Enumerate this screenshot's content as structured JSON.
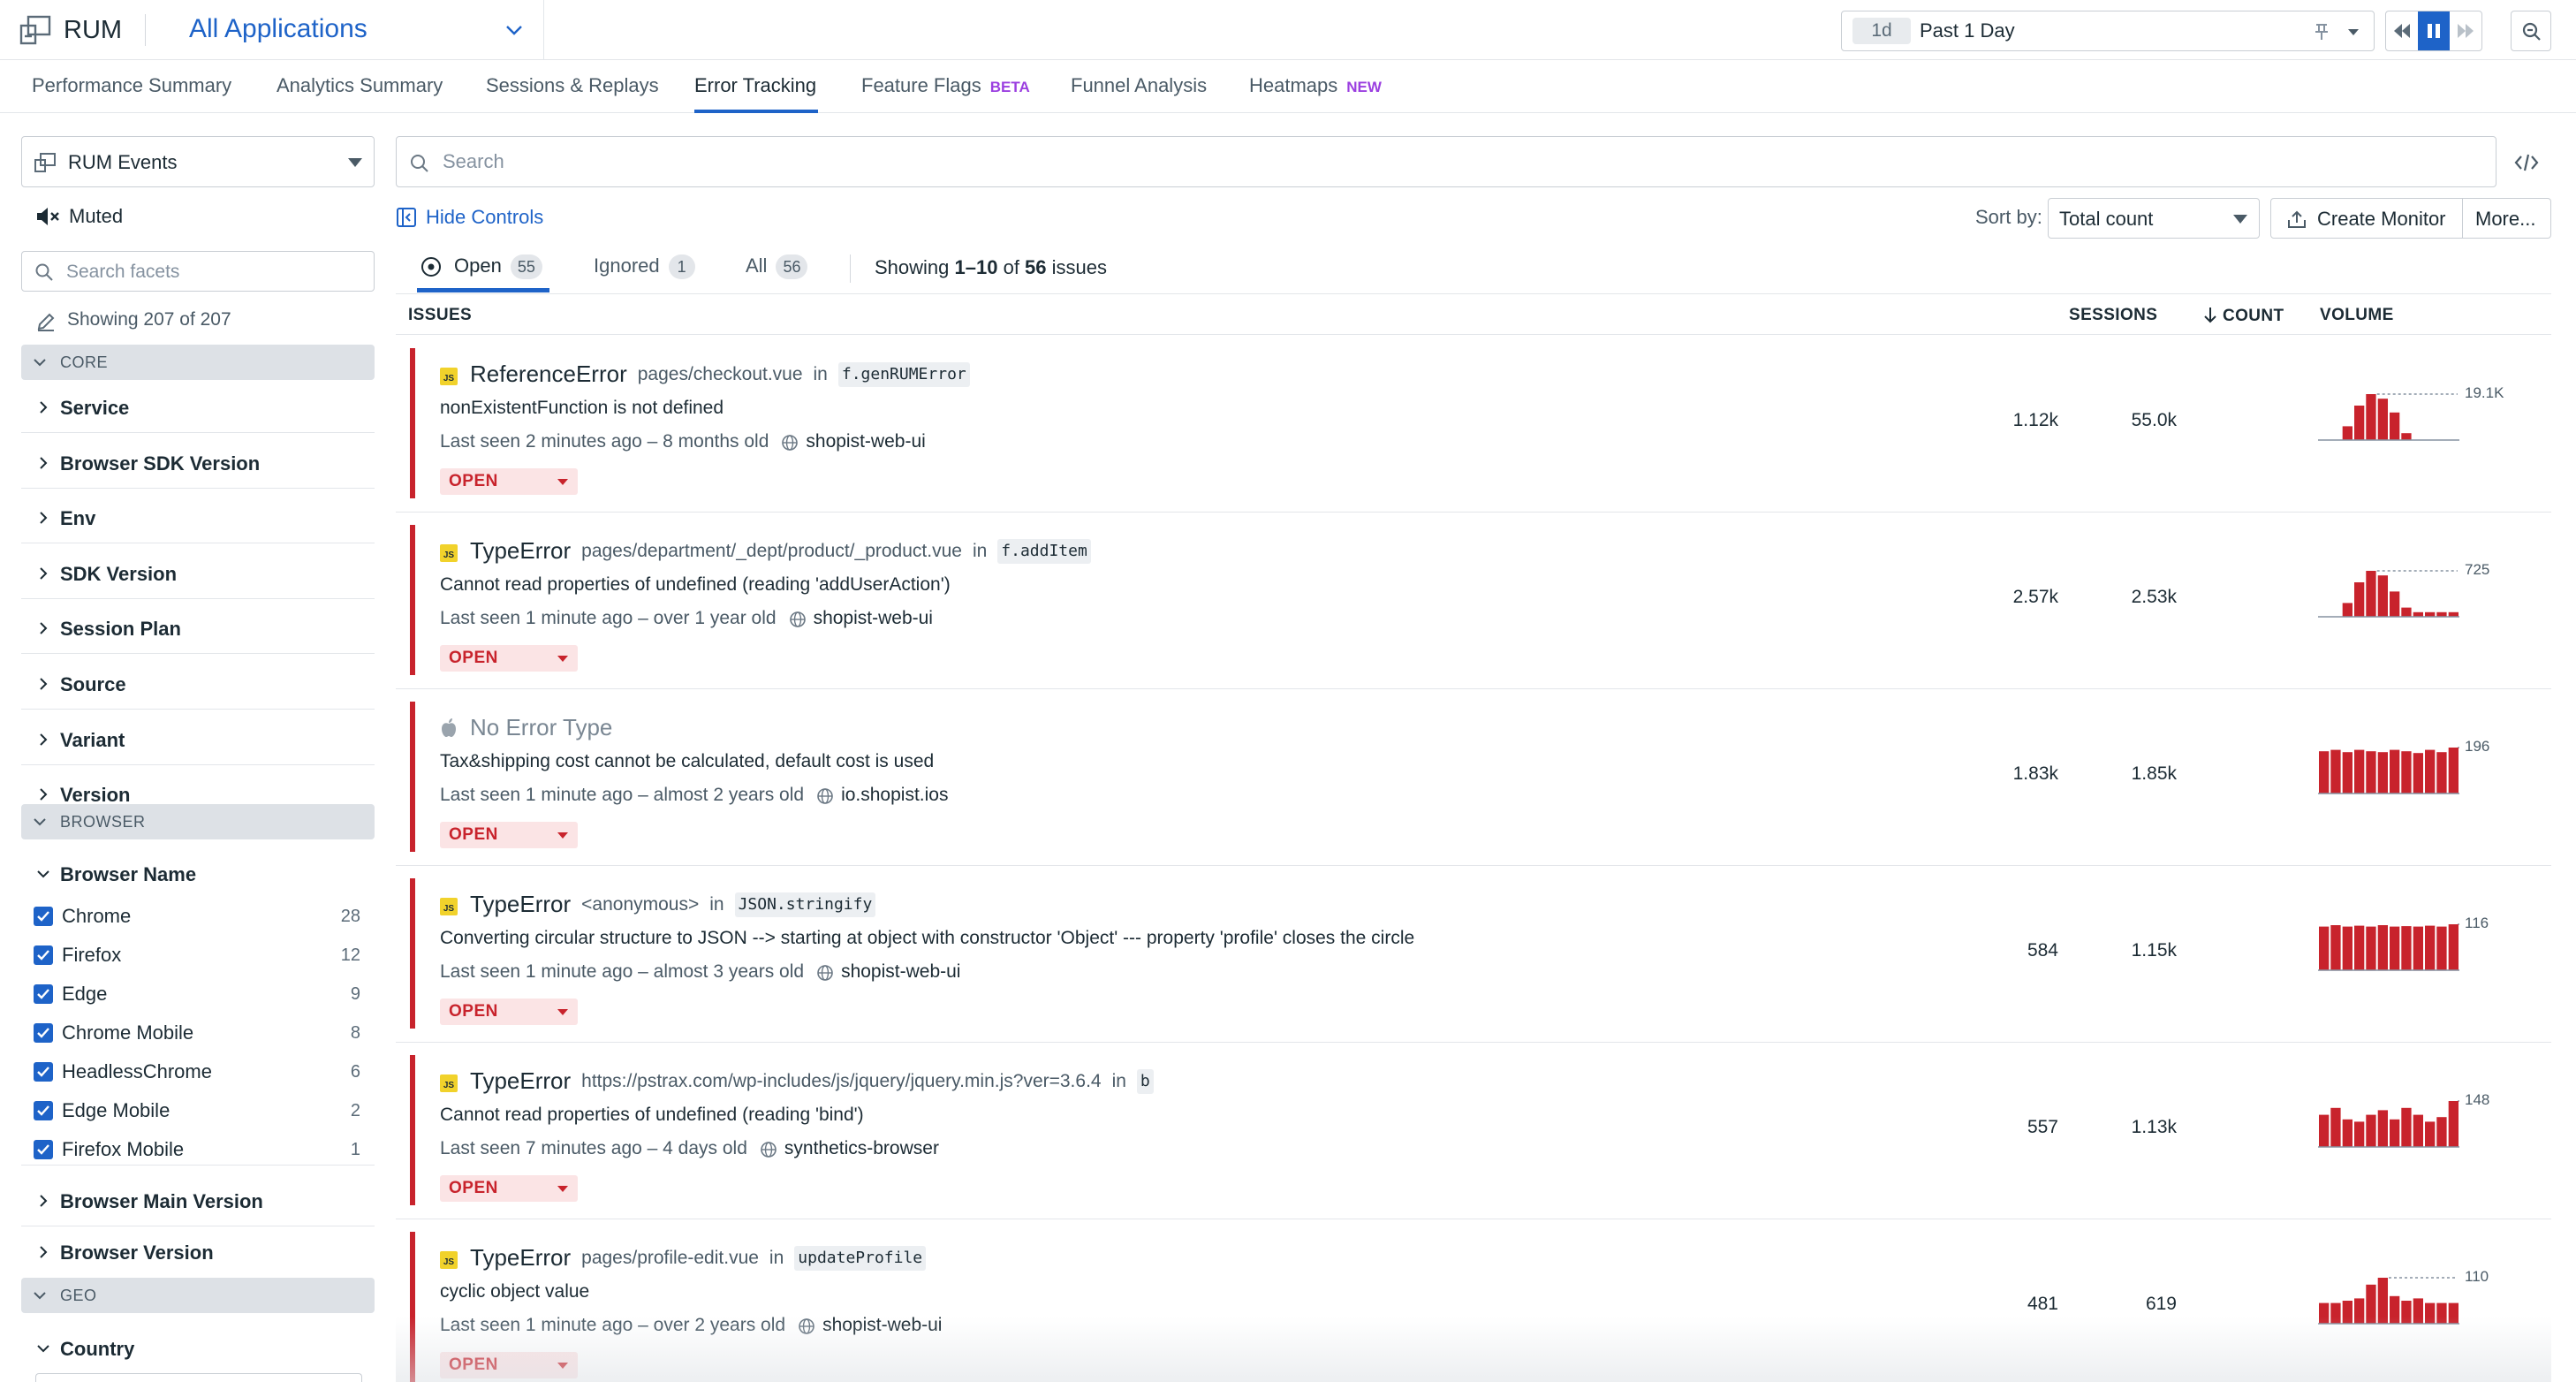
{
  "app": {
    "title": "RUM",
    "application_selector": "All Applications"
  },
  "time_picker": {
    "badge": "1d",
    "label": "Past 1 Day"
  },
  "nav": {
    "tabs": [
      {
        "label": "Performance Summary"
      },
      {
        "label": "Analytics Summary"
      },
      {
        "label": "Sessions & Replays"
      },
      {
        "label": "Error Tracking",
        "active": true
      },
      {
        "label": "Feature Flags",
        "badge": "BETA"
      },
      {
        "label": "Funnel Analysis"
      },
      {
        "label": "Heatmaps",
        "badge": "NEW"
      }
    ]
  },
  "sidebar": {
    "events_select": "RUM Events",
    "muted_label": "Muted",
    "search_placeholder": "Search facets",
    "showing": "Showing 207 of 207",
    "groups": {
      "core": "CORE",
      "browser": "BROWSER",
      "geo": "GEO"
    },
    "core_facets": [
      "Service",
      "Browser SDK Version",
      "Env",
      "SDK Version",
      "Session Plan",
      "Source",
      "Variant",
      "Version"
    ],
    "browser_name": {
      "label": "Browser Name",
      "values": [
        {
          "name": "Chrome",
          "count": "28"
        },
        {
          "name": "Firefox",
          "count": "12"
        },
        {
          "name": "Edge",
          "count": "9"
        },
        {
          "name": "Chrome Mobile",
          "count": "8"
        },
        {
          "name": "HeadlessChrome",
          "count": "6"
        },
        {
          "name": "Edge Mobile",
          "count": "2"
        },
        {
          "name": "Firefox Mobile",
          "count": "1"
        }
      ]
    },
    "browser_facets": [
      "Browser Main Version",
      "Browser Version"
    ],
    "geo_facets": [
      "Country"
    ]
  },
  "main": {
    "search_placeholder": "Search",
    "hide_controls": "Hide Controls",
    "sort_by_label": "Sort by:",
    "sort_value": "Total count",
    "create_monitor": "Create Monitor",
    "more": "More...",
    "status_tabs": [
      {
        "label": "Open",
        "count": "55",
        "active": true
      },
      {
        "label": "Ignored",
        "count": "1"
      },
      {
        "label": "All",
        "count": "56"
      }
    ],
    "showing_prefix": "Showing ",
    "showing_range": "1–10",
    "showing_of": " of ",
    "showing_total": "56",
    "showing_suffix": " issues",
    "columns": {
      "issues": "ISSUES",
      "sessions": "SESSIONS",
      "count": "COUNT",
      "volume": "VOLUME"
    }
  },
  "issues": [
    {
      "type": "ReferenceError",
      "icon": "js-icon",
      "location": "pages/checkout.vue",
      "in": "in",
      "func": "f.genRUMError",
      "message": "nonExistentFunction is not defined",
      "seen": "Last seen 2 minutes ago – 8 months old",
      "service": "shopist-web-ui",
      "status": "OPEN",
      "sessions": "1.12k",
      "count": "55.0k",
      "peak": "19.1K",
      "volume": [
        0,
        0,
        0.3,
        0.75,
        1,
        0.9,
        0.6,
        0.15,
        0,
        0,
        0,
        0
      ]
    },
    {
      "type": "TypeError",
      "icon": "js-icon",
      "location": "pages/department/_dept/product/_product.vue",
      "in": "in",
      "func": "f.addItem",
      "message": "Cannot read properties of undefined (reading 'addUserAction')",
      "seen": "Last seen 1 minute ago – over 1 year old",
      "service": "shopist-web-ui",
      "status": "OPEN",
      "sessions": "2.57k",
      "count": "2.53k",
      "peak": "725",
      "volume": [
        0,
        0,
        0.3,
        0.75,
        1,
        0.9,
        0.55,
        0.2,
        0.1,
        0.1,
        0.1,
        0.1
      ]
    },
    {
      "type": "No Error Type",
      "icon": "apple-icon",
      "location": "",
      "in": "",
      "func": "",
      "message": "Tax&shipping cost cannot be calculated, default cost is used",
      "seen": "Last seen 1 minute ago – almost 2 years old",
      "service": "io.shopist.ios",
      "status": "OPEN",
      "sessions": "1.83k",
      "count": "1.85k",
      "peak": "196",
      "volume": [
        0.92,
        0.95,
        0.9,
        0.95,
        0.92,
        0.9,
        0.95,
        0.92,
        0.88,
        0.95,
        0.9,
        1
      ]
    },
    {
      "type": "TypeError",
      "icon": "js-icon",
      "location": "<anonymous>",
      "in": "in",
      "func": "JSON.stringify",
      "message": "Converting circular structure to JSON --> starting at object with constructor 'Object' --- property 'profile' closes the circle",
      "seen": "Last seen 1 minute ago – almost 3 years old",
      "service": "shopist-web-ui",
      "status": "OPEN",
      "sessions": "584",
      "count": "1.15k",
      "peak": "116",
      "volume": [
        0.95,
        0.98,
        0.95,
        0.97,
        0.95,
        0.98,
        0.95,
        0.96,
        0.95,
        0.97,
        0.95,
        1
      ]
    },
    {
      "type": "TypeError",
      "icon": "js-icon",
      "location": "https://pstrax.com/wp-includes/js/jquery/jquery.min.js?ver=3.6.4",
      "in": "in",
      "func": "b",
      "message": "Cannot read properties of undefined (reading 'bind')",
      "seen": "Last seen 7 minutes ago – 4 days old",
      "service": "synthetics-browser",
      "status": "OPEN",
      "sessions": "557",
      "count": "1.13k",
      "peak": "148",
      "volume": [
        0.7,
        0.85,
        0.6,
        0.55,
        0.7,
        0.8,
        0.6,
        0.85,
        0.7,
        0.55,
        0.65,
        1
      ]
    },
    {
      "type": "TypeError",
      "icon": "js-icon",
      "location": "pages/profile-edit.vue",
      "in": "in",
      "func": "updateProfile",
      "message": "cyclic object value",
      "seen": "Last seen 1 minute ago – over 2 years old",
      "service": "shopist-web-ui",
      "status": "OPEN",
      "sessions": "481",
      "count": "619",
      "peak": "110",
      "volume": [
        0.45,
        0.45,
        0.5,
        0.55,
        0.85,
        1,
        0.6,
        0.5,
        0.55,
        0.45,
        0.45,
        0.45
      ]
    }
  ],
  "colors": {
    "accent": "#1e63c8",
    "error": "#c8232c",
    "open_bg": "#fbe4e5"
  }
}
